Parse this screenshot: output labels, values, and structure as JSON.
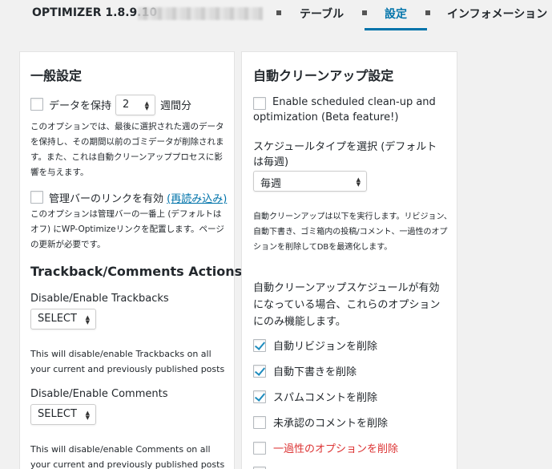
{
  "header": {
    "brand": "OPTIMIZER 1.8.9.10",
    "tabs": [
      {
        "label": "テーブル",
        "active": false
      },
      {
        "label": "設定",
        "active": true
      },
      {
        "label": "インフォメーション",
        "active": false
      }
    ],
    "accent_color": "#0073aa"
  },
  "left": {
    "general_title": "一般設定",
    "keep_data": {
      "label_before": "データを保持",
      "weeks_value": "2",
      "label_after": "週間分",
      "checked": false
    },
    "keep_desc": "このオプションでは、最後に選択された週のデータを保持し、その期間以前のゴミデータが削除されます。また、これは自動クリーンアッププロセスに影響を与えます。",
    "adminbar": {
      "label": "管理バーのリンクを有効",
      "link": "(再読み込み)",
      "checked": false
    },
    "adminbar_desc": "このオプションは管理バーの一番上 (デフォルトはオフ) にWP-Optimizeリンクを配置します。ページの更新が必要です。",
    "trackback_title": "Trackback/Comments Actions",
    "trackbacks_label": "Disable/Enable Trackbacks",
    "trackbacks_select": "SELECT",
    "trackbacks_desc": "This will disable/enable Trackbacks on all your current and previously published posts",
    "comments_label": "Disable/Enable Comments",
    "comments_select": "SELECT",
    "comments_desc": "This will disable/enable Comments on all your current and previously published posts"
  },
  "right": {
    "auto_title": "自動クリーンアップ設定",
    "enable_scheduled": {
      "label": "Enable scheduled clean-up and optimization (Beta feature!)",
      "checked": false
    },
    "schedule_type_label": "スケジュールタイプを選択 (デフォルトは毎週)",
    "schedule_value": "毎週",
    "auto_desc": "自動クリーンアップは以下を実行します。リビジョン、自動下書き、ゴミ箱内の投稿/コメント、一過性のオプションを削除してDBを最適化します。",
    "enabled_note": "自動クリーンアップスケジュールが有効になっている場合、これらのオプションにのみ機能します。",
    "options": [
      {
        "label": "自動リビジョンを削除",
        "checked": true,
        "warning": false
      },
      {
        "label": "自動下書きを削除",
        "checked": true,
        "warning": false
      },
      {
        "label": "スパムコメントを削除",
        "checked": true,
        "warning": false
      },
      {
        "label": "未承認のコメントを削除",
        "checked": false,
        "warning": false
      },
      {
        "label": "一過性のオプションを削除",
        "checked": false,
        "warning": true
      }
    ],
    "warning_color": "#dc3232"
  }
}
